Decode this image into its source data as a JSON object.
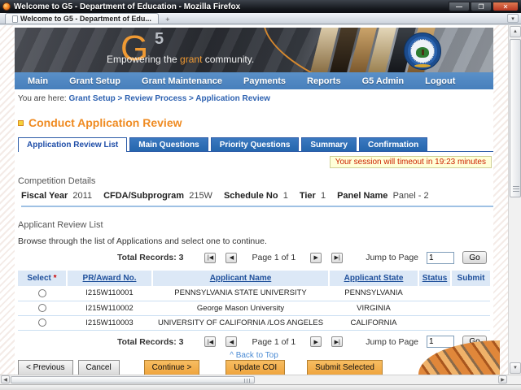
{
  "window": {
    "title": "Welcome to G5 - Department of Education - Mozilla Firefox",
    "tab_title": "Welcome to G5 - Department of Edu...",
    "new_tab_label": "+",
    "controls": {
      "minimize": "—",
      "maximize": "❐",
      "close": "✕"
    }
  },
  "banner": {
    "logo_g": "G",
    "logo_5": "5",
    "tagline_pre": "Empowering the ",
    "tagline_highlight": "grant",
    "tagline_post": " community."
  },
  "nav": {
    "items": [
      "Main",
      "Grant Setup",
      "Grant Maintenance",
      "Payments",
      "Reports",
      "G5 Admin",
      "Logout"
    ]
  },
  "breadcrumb": {
    "prefix": "You are here:",
    "path": "Grant Setup > Review Process > Application Review"
  },
  "page": {
    "title": "Conduct Application Review"
  },
  "tabs": [
    {
      "label": "Application Review List",
      "active": true
    },
    {
      "label": "Main Questions",
      "active": false
    },
    {
      "label": "Priority Questions",
      "active": false
    },
    {
      "label": "Summary",
      "active": false
    },
    {
      "label": "Confirmation",
      "active": false
    }
  ],
  "session": {
    "message": "Your session will timeout in 19:23 minutes"
  },
  "competition": {
    "heading": "Competition Details",
    "fields": [
      {
        "label": "Fiscal Year",
        "value": "2011"
      },
      {
        "label": "CFDA/Subprogram",
        "value": "215W"
      },
      {
        "label": "Schedule No",
        "value": "1"
      },
      {
        "label": "Tier",
        "value": "1"
      },
      {
        "label": "Panel Name",
        "value": "Panel - 2"
      }
    ]
  },
  "list": {
    "heading": "Applicant Review List",
    "instructions": "Browse through the list of Applications and select one to continue.",
    "pagination": {
      "total_label": "Total Records: 3",
      "page_label": "Page 1 of 1",
      "jump_label": "Jump to Page",
      "jump_value": "1",
      "go_label": "Go",
      "icons": {
        "first": "|◀",
        "prev": "◀",
        "next": "▶",
        "last": "▶|"
      }
    },
    "table": {
      "required_marker": "*",
      "headers": [
        "Select",
        "PR/Award No.",
        "Applicant Name",
        "Applicant State",
        "Status",
        "Submit"
      ],
      "rows": [
        {
          "award_no": "I215W110001",
          "name": "PENNSYLVANIA STATE UNIVERSITY",
          "state": "PENNSYLVANIA",
          "status": "",
          "submit": ""
        },
        {
          "award_no": "I215W110002",
          "name": "George Mason University",
          "state": "VIRGINIA",
          "status": "",
          "submit": ""
        },
        {
          "award_no": "I215W110003",
          "name": "UNIVERSITY OF CALIFORNIA /LOS ANGELES",
          "state": "CALIFORNIA",
          "status": "",
          "submit": ""
        }
      ]
    }
  },
  "buttons": {
    "previous": "< Previous",
    "cancel": "Cancel",
    "continue": "Continue >",
    "update_coi": "Update COI",
    "submit_selected": "Submit Selected"
  },
  "footer": {
    "back_to_top": "^ Back to Top"
  },
  "colors": {
    "nav_blue": "#4d87c4",
    "tab_blue": "#2d6bb2",
    "heading_orange": "#ef8b22",
    "table_header_bg": "#dce8f6",
    "table_header_text": "#1e4f9b",
    "session_text": "#cc2200",
    "session_bg": "#ffffd8",
    "button_orange": "#f0a94e"
  }
}
